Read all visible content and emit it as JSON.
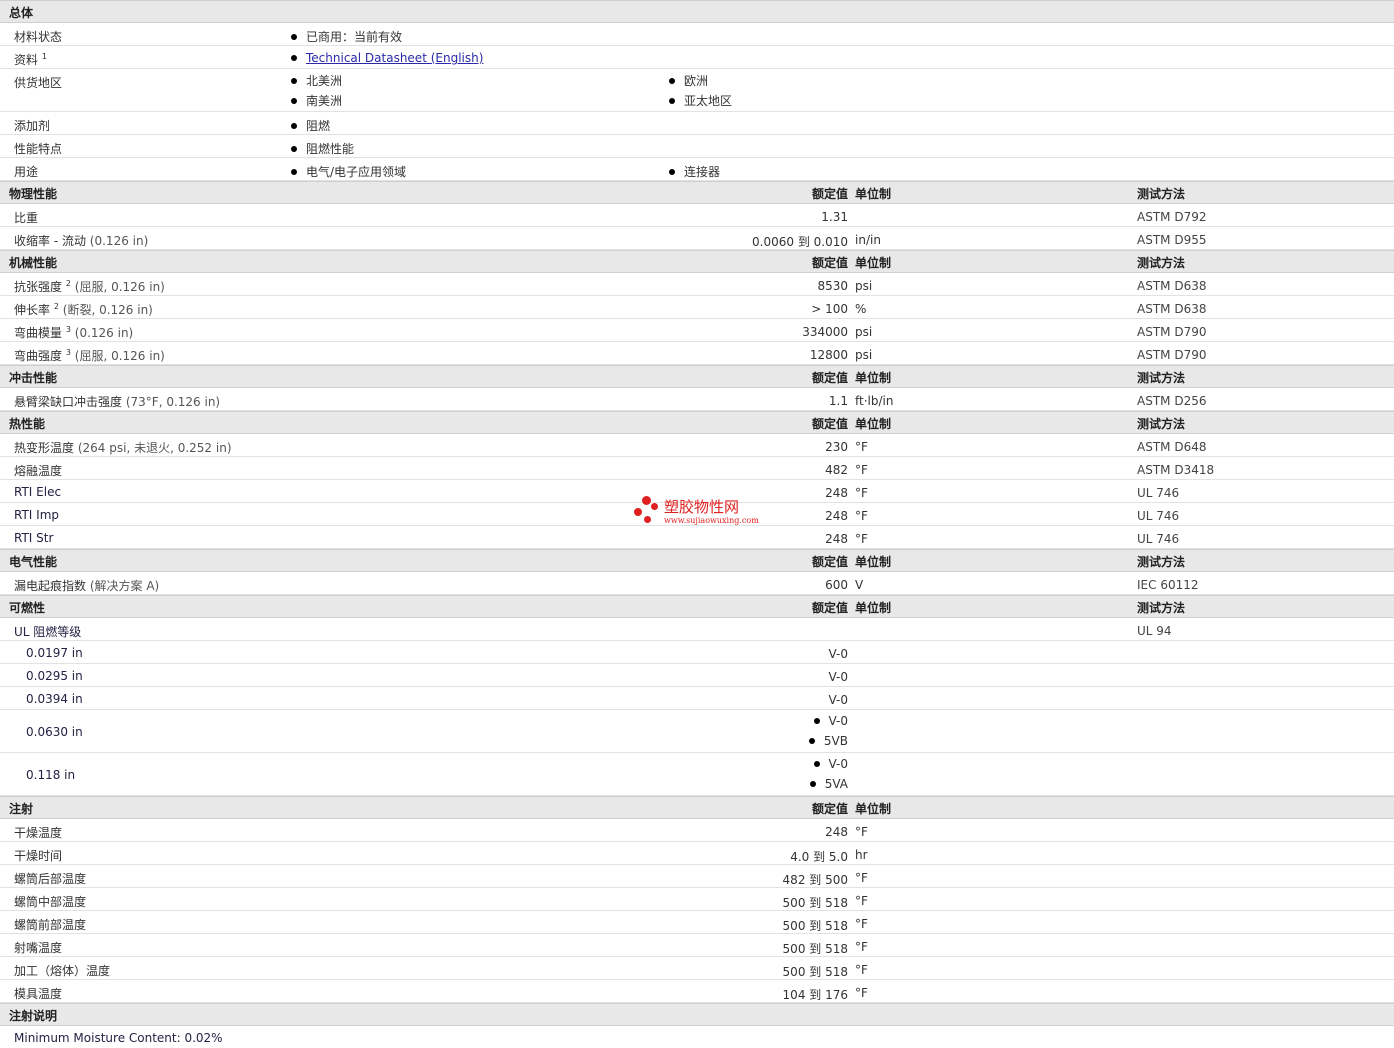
{
  "general": {
    "title": "总体",
    "rows": [
      {
        "label": "材料状态",
        "items": [
          "已商用：当前有效"
        ]
      },
      {
        "label": "资料",
        "sup": "1",
        "link": "Technical Datasheet (English)"
      },
      {
        "label": "供货地区",
        "items": [
          "北美洲",
          "欧洲",
          "南美洲",
          "亚太地区"
        ]
      },
      {
        "label": "添加剂",
        "items": [
          "阻燃"
        ]
      },
      {
        "label": "性能特点",
        "items": [
          "阻燃性能"
        ]
      },
      {
        "label": "用途",
        "items": [
          "电气/电子应用领域",
          "连接器"
        ]
      }
    ]
  },
  "col_headers": {
    "nominal": "额定值",
    "unit": "单位制",
    "test": "测试方法"
  },
  "physical": {
    "title": "物理性能",
    "rows": [
      {
        "label": "比重",
        "value": "1.31",
        "unit": "",
        "test": "ASTM D792"
      },
      {
        "label": "收缩率  - 流动",
        "cond": "(0.126 in)",
        "value": "0.0060 到  0.010",
        "unit": "in/in",
        "test": "ASTM D955"
      }
    ]
  },
  "mechanical": {
    "title": "机械性能",
    "rows": [
      {
        "label": "抗张强度",
        "sup": "2",
        "cond": "(屈服, 0.126 in)",
        "value": "8530",
        "unit": "psi",
        "test": "ASTM D638"
      },
      {
        "label": "伸长率",
        "sup": "2",
        "cond": "(断裂, 0.126 in)",
        "value": "> 100",
        "unit": "%",
        "test": "ASTM D638"
      },
      {
        "label": "弯曲模量",
        "sup": "3",
        "cond": "(0.126 in)",
        "value": "334000",
        "unit": "psi",
        "test": "ASTM D790"
      },
      {
        "label": "弯曲强度",
        "sup": "3",
        "cond": "(屈服, 0.126 in)",
        "value": "12800",
        "unit": "psi",
        "test": "ASTM D790"
      }
    ]
  },
  "impact": {
    "title": "冲击性能",
    "rows": [
      {
        "label": "悬臂梁缺口冲击强度",
        "cond": "(73°F, 0.126 in)",
        "value": "1.1",
        "unit": "ft·lb/in",
        "test": "ASTM D256"
      }
    ]
  },
  "thermal": {
    "title": "热性能",
    "rows": [
      {
        "label": "热变形温度",
        "cond": "(264 psi, 未退火, 0.252 in)",
        "value": "230",
        "unit": "°F",
        "test": "ASTM D648"
      },
      {
        "label": "熔融温度",
        "value": "482",
        "unit": "°F",
        "test": "ASTM D3418"
      },
      {
        "label": "RTI Elec",
        "value": "248",
        "unit": "°F",
        "test": "UL 746"
      },
      {
        "label": "RTI Imp",
        "value": "248",
        "unit": "°F",
        "test": "UL 746"
      },
      {
        "label": "RTI Str",
        "value": "248",
        "unit": "°F",
        "test": "UL 746"
      }
    ]
  },
  "electrical": {
    "title": "电气性能",
    "rows": [
      {
        "label": "漏电起痕指数",
        "cond": "(解决方案  A)",
        "value": "600",
        "unit": "V",
        "test": "IEC 60112"
      }
    ]
  },
  "flammability": {
    "title": "可燃性",
    "main": {
      "label": "UL 阻燃等级",
      "test": "UL 94"
    },
    "rows": [
      {
        "label": "0.0197 in",
        "value": "V-0"
      },
      {
        "label": "0.0295 in",
        "value": "V-0"
      },
      {
        "label": "0.0394 in",
        "value": "V-0"
      },
      {
        "label": "0.0630 in",
        "items": [
          "V-0",
          "5VB"
        ]
      },
      {
        "label": "0.118 in",
        "items": [
          "V-0",
          "5VA"
        ]
      }
    ]
  },
  "injection": {
    "title": "注射",
    "rows": [
      {
        "label": "干燥温度",
        "value": "248",
        "unit": "°F"
      },
      {
        "label": "干燥时间",
        "value": "4.0 到  5.0",
        "unit": "hr"
      },
      {
        "label": "螺筒后部温度",
        "value": "482 到  500",
        "unit": "°F"
      },
      {
        "label": "螺筒中部温度",
        "value": "500 到  518",
        "unit": "°F"
      },
      {
        "label": "螺筒前部温度",
        "value": "500 到  518",
        "unit": "°F"
      },
      {
        "label": "射嘴温度",
        "value": "500 到  518",
        "unit": "°F"
      },
      {
        "label": "加工（熔体）温度",
        "value": "500 到  518",
        "unit": "°F"
      },
      {
        "label": "模具温度",
        "value": "104 到  176",
        "unit": "°F"
      }
    ]
  },
  "injection_notes": {
    "title": "注射说明",
    "text": "Minimum Moisture Content: 0.02%"
  },
  "watermark": {
    "name": "塑胶物性网",
    "url": "www.sujiaowuxing.com",
    "color": "#e02020"
  }
}
